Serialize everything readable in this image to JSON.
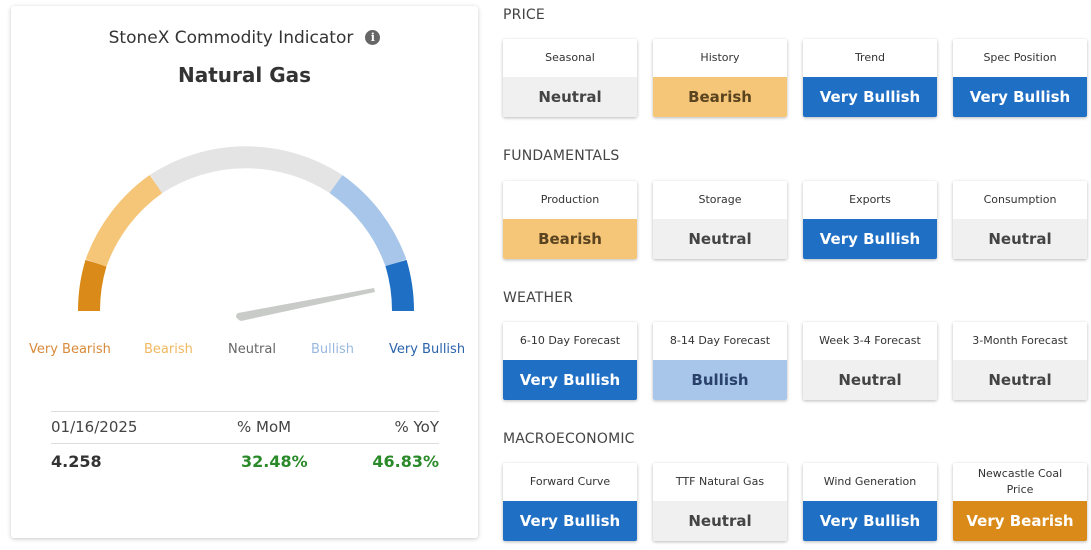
{
  "indicator": {
    "title": "StoneX Commodity Indicator",
    "info_icon": "info-icon",
    "commodity": "Natural Gas",
    "gauge": {
      "needle_level": 0.93,
      "segment_colors": {
        "very_bearish": "#d98a18",
        "bearish": "#f5c578",
        "neutral": "#e3e4e3",
        "bullish": "#a8c6e9",
        "very_bullish": "#1f6fc4"
      }
    },
    "labels": {
      "very_bearish": "Very Bearish",
      "bearish": "Bearish",
      "neutral": "Neutral",
      "bullish": "Bullish",
      "very_bullish": "Very Bullish"
    },
    "stats": {
      "date": "01/16/2025",
      "mom_label": "% MoM",
      "yoy_label": "% YoY",
      "price": "4.258",
      "mom": "32.48%",
      "yoy": "46.83%"
    }
  },
  "sections": [
    {
      "title": "PRICE",
      "cards": [
        {
          "label": "Seasonal",
          "status": "Neutral",
          "style": "neutral"
        },
        {
          "label": "History",
          "status": "Bearish",
          "style": "bearish"
        },
        {
          "label": "Trend",
          "status": "Very Bullish",
          "style": "verybullish"
        },
        {
          "label": "Spec Position",
          "status": "Very Bullish",
          "style": "verybullish"
        }
      ]
    },
    {
      "title": "FUNDAMENTALS",
      "cards": [
        {
          "label": "Production",
          "status": "Bearish",
          "style": "bearish"
        },
        {
          "label": "Storage",
          "status": "Neutral",
          "style": "neutral"
        },
        {
          "label": "Exports",
          "status": "Very Bullish",
          "style": "verybullish"
        },
        {
          "label": "Consumption",
          "status": "Neutral",
          "style": "neutral"
        }
      ]
    },
    {
      "title": "WEATHER",
      "cards": [
        {
          "label": "6-10 Day Forecast",
          "status": "Very Bullish",
          "style": "verybullish"
        },
        {
          "label": "8-14 Day Forecast",
          "status": "Bullish",
          "style": "bullish"
        },
        {
          "label": "Week 3-4 Forecast",
          "status": "Neutral",
          "style": "neutral"
        },
        {
          "label": "3-Month Forecast",
          "status": "Neutral",
          "style": "neutral"
        }
      ]
    },
    {
      "title": "MACROECONOMIC",
      "cards": [
        {
          "label": "Forward Curve",
          "status": "Very Bullish",
          "style": "verybullish"
        },
        {
          "label": "TTF Natural Gas",
          "status": "Neutral",
          "style": "neutral"
        },
        {
          "label": "Wind Generation",
          "status": "Very Bullish",
          "style": "verybullish"
        },
        {
          "label": "Newcastle Coal Price",
          "status": "Very Bearish",
          "style": "verybearish"
        }
      ]
    }
  ]
}
